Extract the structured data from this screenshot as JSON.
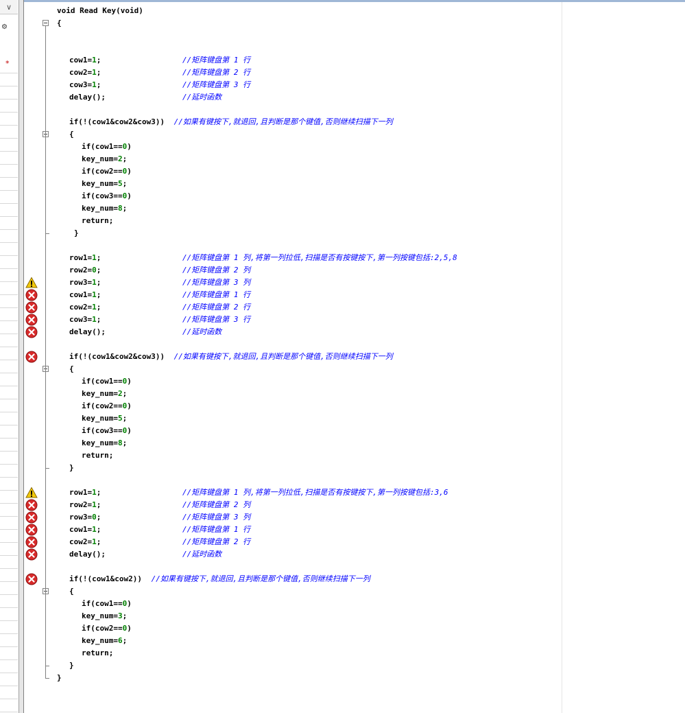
{
  "left_panel": {
    "dropdown_glyph": "∨",
    "icon_glyph": "⚙",
    "modified_marker": "*"
  },
  "colors": {
    "keyword": "#000000",
    "comment": "#0000ff",
    "number": "#008000",
    "error": "#d82a2a",
    "warning": "#f2c90c"
  },
  "lines": [
    {
      "text": "void Read Key(void)",
      "comment": "",
      "indent": 0,
      "marker": "",
      "fold": ""
    },
    {
      "text": "{",
      "comment": "",
      "indent": 0,
      "marker": "",
      "fold": "start"
    },
    {
      "text": "",
      "comment": "",
      "indent": 0,
      "marker": "",
      "fold": ""
    },
    {
      "text": "",
      "comment": "",
      "indent": 0,
      "marker": "",
      "fold": ""
    },
    {
      "text": "cow1=1;",
      "comment": "//矩阵键盘第 1 行",
      "indent": 2,
      "marker": "",
      "fold": ""
    },
    {
      "text": "cow2=1;",
      "comment": "//矩阵键盘第 2 行",
      "indent": 2,
      "marker": "",
      "fold": ""
    },
    {
      "text": "cow3=1;",
      "comment": "//矩阵键盘第 3 行",
      "indent": 2,
      "marker": "",
      "fold": ""
    },
    {
      "text": "delay();",
      "comment": "//延时函数",
      "indent": 2,
      "marker": "",
      "fold": ""
    },
    {
      "text": "",
      "comment": "",
      "indent": 0,
      "marker": "",
      "fold": ""
    },
    {
      "text": "if(!(cow1&cow2&cow3))",
      "comment": "//如果有键按下,就退回,且判断是那个键值,否则继续扫描下一列",
      "indent": 2,
      "marker": "",
      "fold": ""
    },
    {
      "text": "{",
      "comment": "",
      "indent": 2,
      "marker": "",
      "fold": "start"
    },
    {
      "text": "if(cow1==0)",
      "comment": "",
      "indent": 4,
      "marker": "",
      "fold": ""
    },
    {
      "text": "key_num=2;",
      "comment": "",
      "indent": 4,
      "marker": "",
      "fold": ""
    },
    {
      "text": "if(cow2==0)",
      "comment": "",
      "indent": 4,
      "marker": "",
      "fold": ""
    },
    {
      "text": "key_num=5;",
      "comment": "",
      "indent": 4,
      "marker": "",
      "fold": ""
    },
    {
      "text": "if(cow3==0)",
      "comment": "",
      "indent": 4,
      "marker": "",
      "fold": ""
    },
    {
      "text": "key_num=8;",
      "comment": "",
      "indent": 4,
      "marker": "",
      "fold": ""
    },
    {
      "text": "return;",
      "comment": "",
      "indent": 4,
      "marker": "",
      "fold": ""
    },
    {
      "text": "}",
      "comment": "",
      "indent": 3,
      "marker": "",
      "fold": "end"
    },
    {
      "text": "",
      "comment": "",
      "indent": 0,
      "marker": "",
      "fold": ""
    },
    {
      "text": "row1=1;",
      "comment": "//矩阵键盘第 1 列,将第一列拉低,扫描是否有按键按下,第一列按键包括:2,5,8",
      "indent": 2,
      "marker": "",
      "fold": ""
    },
    {
      "text": "row2=0;",
      "comment": "//矩阵键盘第 2 列",
      "indent": 2,
      "marker": "",
      "fold": ""
    },
    {
      "text": "row3=1;",
      "comment": "//矩阵键盘第 3 列",
      "indent": 2,
      "marker": "warning",
      "fold": ""
    },
    {
      "text": "cow1=1;",
      "comment": "//矩阵键盘第 1 行",
      "indent": 2,
      "marker": "error",
      "fold": ""
    },
    {
      "text": "cow2=1;",
      "comment": "//矩阵键盘第 2 行",
      "indent": 2,
      "marker": "error",
      "fold": ""
    },
    {
      "text": "cow3=1;",
      "comment": "//矩阵键盘第 3 行",
      "indent": 2,
      "marker": "error",
      "fold": ""
    },
    {
      "text": "delay();",
      "comment": "//延时函数",
      "indent": 2,
      "marker": "error",
      "fold": ""
    },
    {
      "text": "",
      "comment": "",
      "indent": 0,
      "marker": "",
      "fold": ""
    },
    {
      "text": "if(!(cow1&cow2&cow3))",
      "comment": "//如果有键按下,就退回,且判断是那个键值,否则继续扫描下一列",
      "indent": 2,
      "marker": "error",
      "fold": ""
    },
    {
      "text": "{",
      "comment": "",
      "indent": 2,
      "marker": "",
      "fold": "start"
    },
    {
      "text": "if(cow1==0)",
      "comment": "",
      "indent": 4,
      "marker": "",
      "fold": ""
    },
    {
      "text": "key_num=2;",
      "comment": "",
      "indent": 4,
      "marker": "",
      "fold": ""
    },
    {
      "text": "if(cow2==0)",
      "comment": "",
      "indent": 4,
      "marker": "",
      "fold": ""
    },
    {
      "text": "key_num=5;",
      "comment": "",
      "indent": 4,
      "marker": "",
      "fold": ""
    },
    {
      "text": "if(cow3==0)",
      "comment": "",
      "indent": 4,
      "marker": "",
      "fold": ""
    },
    {
      "text": "key_num=8;",
      "comment": "",
      "indent": 4,
      "marker": "",
      "fold": ""
    },
    {
      "text": "return;",
      "comment": "",
      "indent": 4,
      "marker": "",
      "fold": ""
    },
    {
      "text": "}",
      "comment": "",
      "indent": 2,
      "marker": "",
      "fold": "end"
    },
    {
      "text": "",
      "comment": "",
      "indent": 0,
      "marker": "",
      "fold": ""
    },
    {
      "text": "row1=1;",
      "comment": "//矩阵键盘第 1 列,将第一列拉低,扫描是否有按键按下,第一列按键包括:3,6",
      "indent": 2,
      "marker": "warning",
      "fold": ""
    },
    {
      "text": "row2=1;",
      "comment": "//矩阵键盘第 2 列",
      "indent": 2,
      "marker": "error",
      "fold": ""
    },
    {
      "text": "row3=0;",
      "comment": "//矩阵键盘第 3 列",
      "indent": 2,
      "marker": "error",
      "fold": ""
    },
    {
      "text": "cow1=1;",
      "comment": "//矩阵键盘第 1 行",
      "indent": 2,
      "marker": "error",
      "fold": ""
    },
    {
      "text": "cow2=1;",
      "comment": "//矩阵键盘第 2 行",
      "indent": 2,
      "marker": "error",
      "fold": ""
    },
    {
      "text": "delay();",
      "comment": "//延时函数",
      "indent": 2,
      "marker": "error",
      "fold": ""
    },
    {
      "text": "",
      "comment": "",
      "indent": 0,
      "marker": "",
      "fold": ""
    },
    {
      "text": "if(!(cow1&cow2))",
      "comment": "//如果有键按下,就退回,且判断是那个键值,否则继续扫描下一列",
      "indent": 2,
      "marker": "error",
      "fold": ""
    },
    {
      "text": "{",
      "comment": "",
      "indent": 2,
      "marker": "",
      "fold": "start"
    },
    {
      "text": "if(cow1==0)",
      "comment": "",
      "indent": 4,
      "marker": "",
      "fold": ""
    },
    {
      "text": "key_num=3;",
      "comment": "",
      "indent": 4,
      "marker": "",
      "fold": ""
    },
    {
      "text": "if(cow2==0)",
      "comment": "",
      "indent": 4,
      "marker": "",
      "fold": ""
    },
    {
      "text": "key_num=6;",
      "comment": "",
      "indent": 4,
      "marker": "",
      "fold": ""
    },
    {
      "text": "return;",
      "comment": "",
      "indent": 4,
      "marker": "",
      "fold": ""
    },
    {
      "text": "}",
      "comment": "",
      "indent": 2,
      "marker": "",
      "fold": "end"
    },
    {
      "text": "}",
      "comment": "",
      "indent": 0,
      "marker": "",
      "fold": "end-outer"
    }
  ]
}
